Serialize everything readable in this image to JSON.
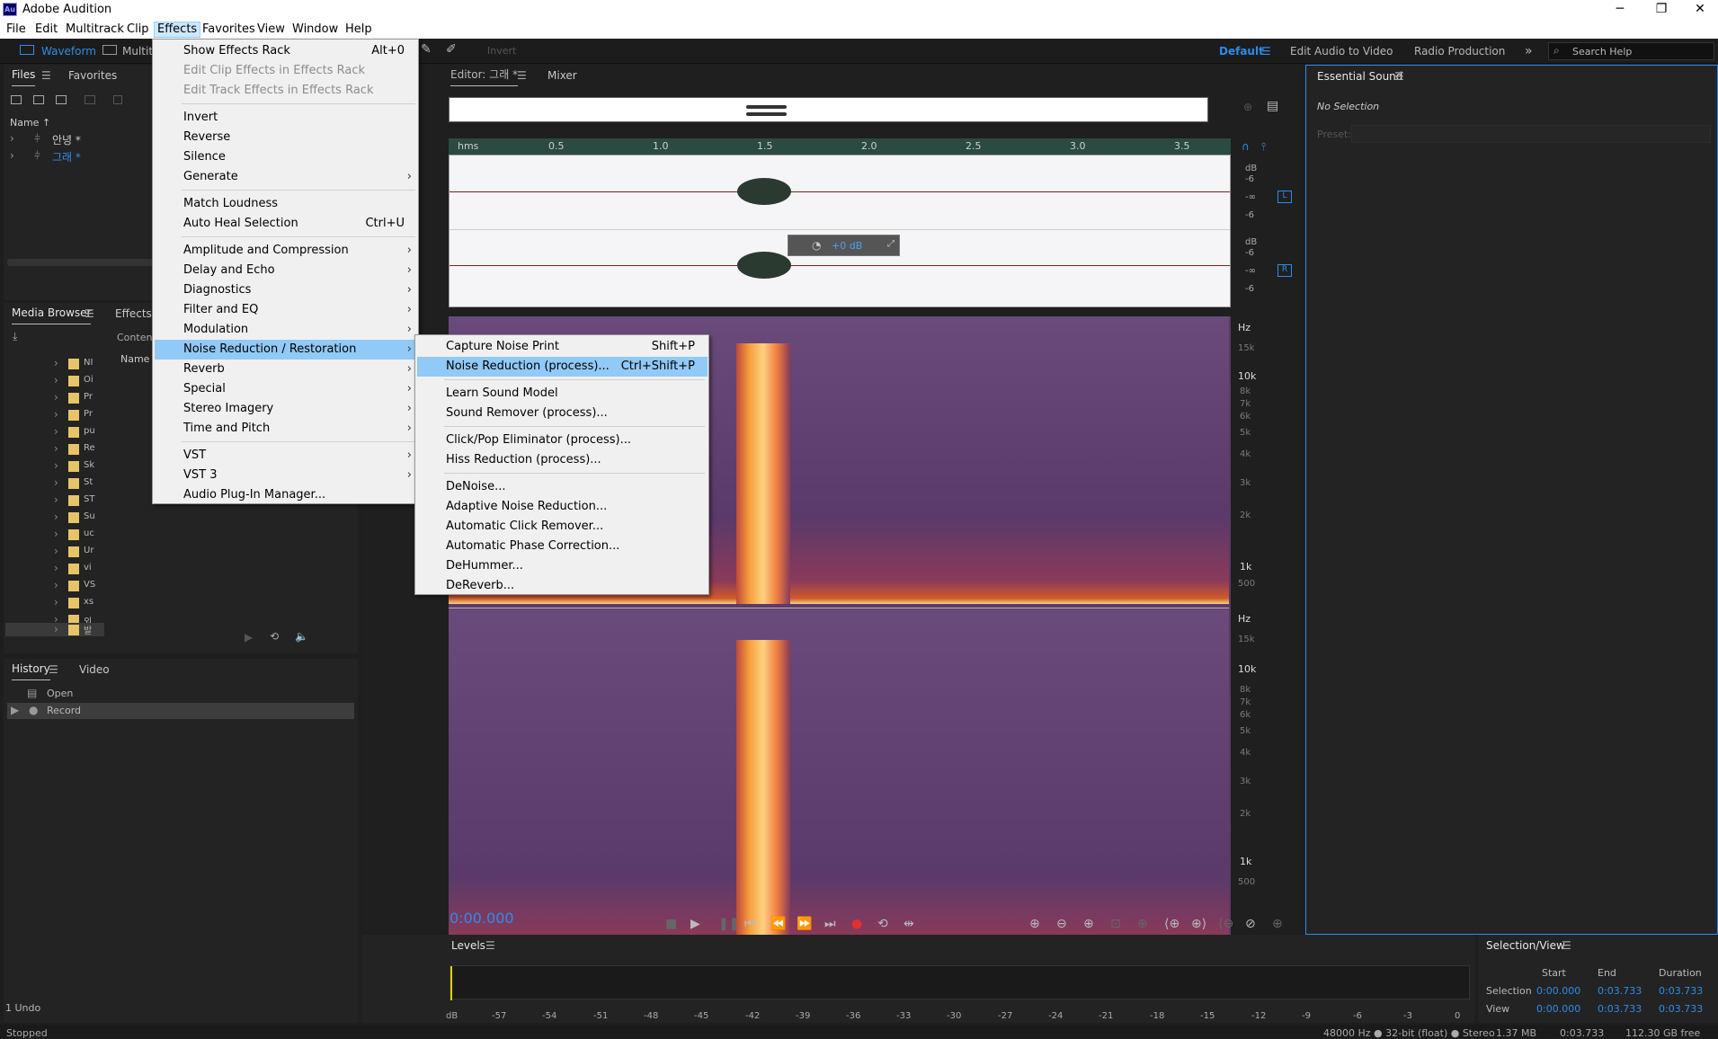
{
  "app": {
    "title": "Adobe Audition",
    "logo": "Au"
  },
  "window_controls": {
    "minimize": "─",
    "restore": "❐",
    "close": "✕"
  },
  "menubar": [
    "File",
    "Edit",
    "Multitrack",
    "Clip",
    "Effects",
    "Favorites",
    "View",
    "Window",
    "Help"
  ],
  "toolbar": {
    "waveform": "Waveform",
    "multitrack": "Multitr",
    "invert": "Invert",
    "workspace_default": "Default",
    "workspace_video": "Edit Audio to Video",
    "workspace_radio": "Radio Production",
    "search": "Search Help"
  },
  "files_panel": {
    "tab": "Files",
    "tab2": "Favorites",
    "col_name": "Name ↑",
    "items": [
      {
        "name": "안녕 *"
      },
      {
        "name": "그래 *"
      }
    ]
  },
  "media_panel": {
    "tab": "Media Browser",
    "tab2": "Effects R",
    "contents": "Content",
    "name_col": "Name",
    "folders": [
      "NI",
      "Oi",
      "Pr",
      "Pr",
      "pu",
      "Re",
      "Sk",
      "St",
      "ST",
      "Su",
      "uc",
      "Ur",
      "vi",
      "VS",
      "xs",
      "외",
      "발"
    ]
  },
  "history_panel": {
    "tab": "History",
    "tab2": "Video",
    "items": [
      "Open",
      "Record"
    ],
    "undo": "1 Undo"
  },
  "editor": {
    "tab": "Editor: 그래 *",
    "tab2": "Mixer",
    "timecode": "0:00.000",
    "hud_db": "+0 dB",
    "ruler": [
      "hms",
      "0.5",
      "1.0",
      "1.5",
      "2.0",
      "2.5",
      "3.0",
      "3.5"
    ],
    "db_labels": [
      "dB",
      "-6",
      "-∞",
      "-6"
    ],
    "channel_left": "L",
    "channel_right": "R",
    "hz_major": [
      "Hz",
      "10k",
      "1k"
    ],
    "hz_minor": [
      "15k",
      "8k",
      "7k",
      "6k",
      "5k",
      "4k",
      "3k",
      "2k",
      "500"
    ]
  },
  "effects_menu": [
    {
      "label": "Show Effects Rack",
      "shortcut": "Alt+0"
    },
    {
      "label": "Edit Clip Effects in Effects Rack",
      "disabled": true
    },
    {
      "label": "Edit Track Effects in Effects Rack",
      "disabled": true
    },
    {
      "label": "Invert"
    },
    {
      "label": "Reverse"
    },
    {
      "label": "Silence"
    },
    {
      "label": "Generate",
      "sub": true
    },
    {
      "label": "Match Loudness"
    },
    {
      "label": "Auto Heal Selection",
      "shortcut": "Ctrl+U"
    },
    {
      "label": "Amplitude and Compression",
      "sub": true
    },
    {
      "label": "Delay and Echo",
      "sub": true
    },
    {
      "label": "Diagnostics",
      "sub": true
    },
    {
      "label": "Filter and EQ",
      "sub": true
    },
    {
      "label": "Modulation",
      "sub": true
    },
    {
      "label": "Noise Reduction / Restoration",
      "sub": true,
      "selected": true
    },
    {
      "label": "Reverb",
      "sub": true
    },
    {
      "label": "Special",
      "sub": true
    },
    {
      "label": "Stereo Imagery",
      "sub": true
    },
    {
      "label": "Time and Pitch",
      "sub": true
    },
    {
      "label": "VST",
      "sub": true
    },
    {
      "label": "VST 3",
      "sub": true
    },
    {
      "label": "Audio Plug-In Manager..."
    }
  ],
  "noise_submenu": [
    {
      "label": "Capture Noise Print",
      "shortcut": "Shift+P"
    },
    {
      "label": "Noise Reduction (process)...",
      "shortcut": "Ctrl+Shift+P",
      "selected": true
    },
    {
      "label": "Learn Sound Model"
    },
    {
      "label": "Sound Remover (process)..."
    },
    {
      "label": "Click/Pop Eliminator (process)..."
    },
    {
      "label": "Hiss Reduction (process)..."
    },
    {
      "label": "DeNoise..."
    },
    {
      "label": "Adaptive Noise Reduction..."
    },
    {
      "label": "Automatic Click Remover..."
    },
    {
      "label": "Automatic Phase Correction..."
    },
    {
      "label": "DeHummer..."
    },
    {
      "label": "DeReverb..."
    }
  ],
  "essential_sound": {
    "tab": "Essential Sound",
    "no_selection": "No Selection",
    "preset": "Preset:"
  },
  "levels": {
    "tab": "Levels",
    "scale": [
      "dB",
      "-57",
      "-54",
      "-51",
      "-48",
      "-45",
      "-42",
      "-39",
      "-36",
      "-33",
      "-30",
      "-27",
      "-24",
      "-21",
      "-18",
      "-15",
      "-12",
      "-9",
      "-6",
      "-3",
      "0"
    ]
  },
  "selection_view": {
    "tab": "Selection/View",
    "cols": [
      "Start",
      "End",
      "Duration"
    ],
    "rows": [
      {
        "label": "Selection",
        "start": "0:00.000",
        "end": "0:03.733",
        "duration": "0:03.733"
      },
      {
        "label": "View",
        "start": "0:00.000",
        "end": "0:03.733",
        "duration": "0:03.733"
      }
    ]
  },
  "status": {
    "state": "Stopped",
    "sample": "48000 Hz ● 32-bit (float) ● Stereo",
    "size": "1.37 MB",
    "duration": "0:03.733",
    "free": "112.30 GB free"
  },
  "colors": {
    "accent": "#2d8ceb",
    "menu_highlight": "#91c9f7",
    "spectro": "#5a3a6a"
  }
}
